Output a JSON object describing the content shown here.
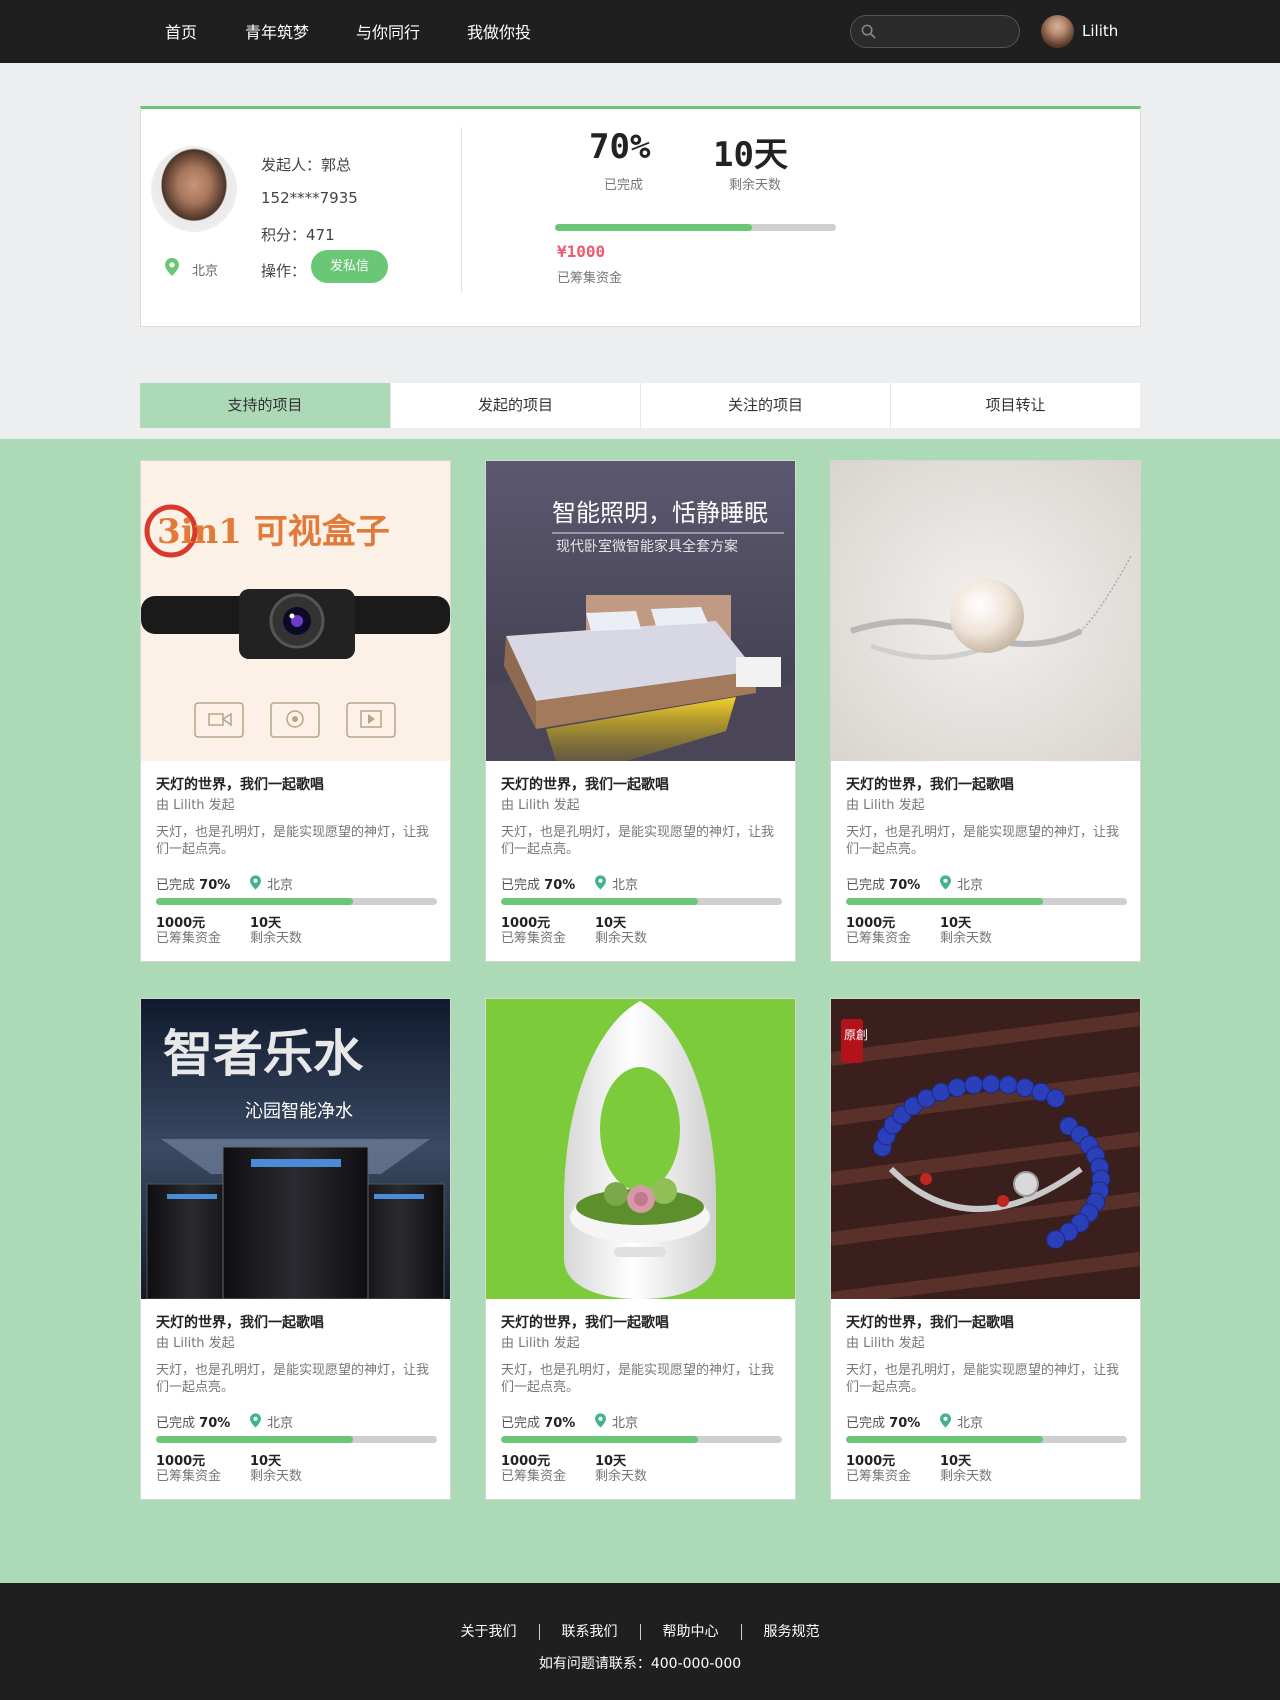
{
  "nav": {
    "links": [
      "首页",
      "青年筑梦",
      "与你同行",
      "我做你投"
    ],
    "search_placeholder": "",
    "user_name": "Lilith"
  },
  "profile": {
    "initiator": "发起人：郭总",
    "phone": "152****7935",
    "points": "积分：471",
    "action_label": "操作：",
    "pm_button": "发私信",
    "city": "北京",
    "percent": "70%",
    "percent_label": "已完成",
    "days": "10天",
    "days_label": "剩余天数",
    "progress": 0.7,
    "raised": "¥1000",
    "raised_label": "已筹集资金"
  },
  "tabs": [
    "支持的项目",
    "发起的项目",
    "关注的项目",
    "项目转让"
  ],
  "active_tab": 0,
  "cards": [
    {
      "image": "camera-box",
      "image_title": "3in1 可视盒子",
      "title": "天灯的世界，我们一起歌唱",
      "author": "由 Lilith 发起",
      "desc": "天灯，也是孔明灯，是能实现愿望的神灯，让我们一起点亮。",
      "done_label": "已完成",
      "done": "70%",
      "city": "北京",
      "progress": 0.7,
      "money": "1000元",
      "money_label": "已筹集资金",
      "days": "10天",
      "days_label": "剩余天数"
    },
    {
      "image": "smart-bed",
      "image_title": "智能照明，恬静睡眠",
      "image_sub": "现代卧室微智能家具全套方案",
      "title": "天灯的世界，我们一起歌唱",
      "author": "由 Lilith 发起",
      "desc": "天灯，也是孔明灯，是能实现愿望的神灯，让我们一起点亮。",
      "done_label": "已完成",
      "done": "70%",
      "city": "北京",
      "progress": 0.7,
      "money": "1000元",
      "money_label": "已筹集资金",
      "days": "10天",
      "days_label": "剩余天数"
    },
    {
      "image": "pearl-bracelet",
      "title": "天灯的世界，我们一起歌唱",
      "author": "由 Lilith 发起",
      "desc": "天灯，也是孔明灯，是能实现愿望的神灯，让我们一起点亮。",
      "done_label": "已完成",
      "done": "70%",
      "city": "北京",
      "progress": 0.7,
      "money": "1000元",
      "money_label": "已筹集资金",
      "days": "10天",
      "days_label": "剩余天数"
    },
    {
      "image": "water-purifier",
      "image_title": "智者乐水",
      "image_sub": "沁园智能净水",
      "title": "天灯的世界，我们一起歌唱",
      "author": "由 Lilith 发起",
      "desc": "天灯，也是孔明灯，是能实现愿望的神灯，让我们一起点亮。",
      "done_label": "已完成",
      "done": "70%",
      "city": "北京",
      "progress": 0.7,
      "money": "1000元",
      "money_label": "已筹集资金",
      "days": "10天",
      "days_label": "剩余天数"
    },
    {
      "image": "smart-planter",
      "title": "天灯的世界，我们一起歌唱",
      "author": "由 Lilith 发起",
      "desc": "天灯，也是孔明灯，是能实现愿望的神灯，让我们一起点亮。",
      "done_label": "已完成",
      "done": "70%",
      "city": "北京",
      "progress": 0.7,
      "money": "1000元",
      "money_label": "已筹集资金",
      "days": "10天",
      "days_label": "剩余天数"
    },
    {
      "image": "bead-bracelet",
      "image_title": "原創",
      "title": "天灯的世界，我们一起歌唱",
      "author": "由 Lilith 发起",
      "desc": "天灯，也是孔明灯，是能实现愿望的神灯，让我们一起点亮。",
      "done_label": "已完成",
      "done": "70%",
      "city": "北京",
      "progress": 0.7,
      "money": "1000元",
      "money_label": "已筹集资金",
      "days": "10天",
      "days_label": "剩余天数"
    }
  ],
  "footer": {
    "links": [
      "关于我们",
      "联系我们",
      "帮助中心",
      "服务规范"
    ],
    "contact": "如有问题请联系：400-000-000"
  },
  "colors": {
    "accent": "#6ac776",
    "tab_active": "#acdab6",
    "area_bg": "#acdab6",
    "dark": "#1f1f1f",
    "price": "#ef5b6e"
  }
}
